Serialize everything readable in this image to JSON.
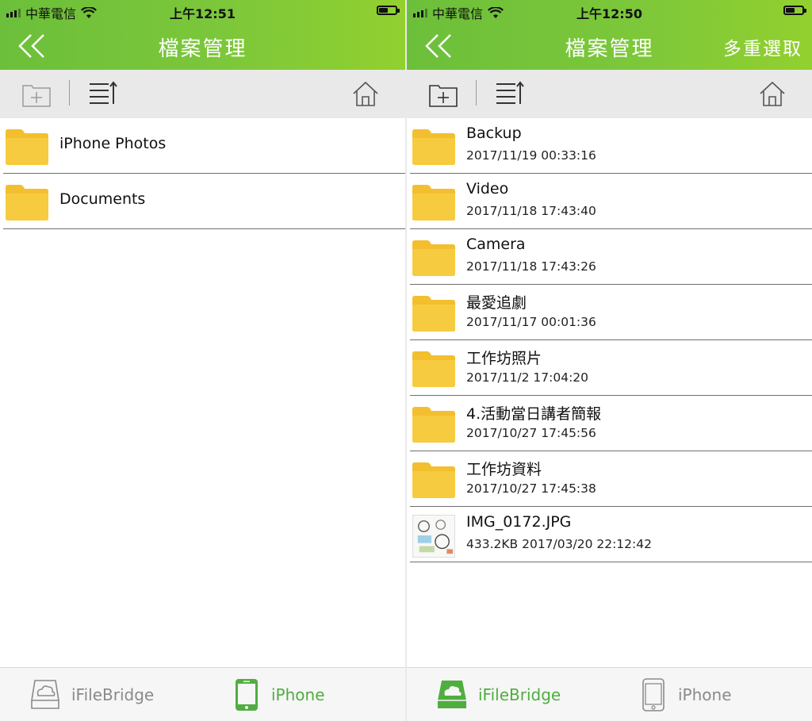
{
  "colors": {
    "accent": "#5cb34a",
    "header_start": "#6cbf3a",
    "header_end": "#92d02f",
    "folder": "#f7c93b",
    "inactive": "#8a8a8a"
  },
  "left": {
    "status": {
      "carrier": "中華電信",
      "time": "上午12:51"
    },
    "nav": {
      "title": "檔案管理",
      "back_icon": "double-chevron-left-icon"
    },
    "toolbar": {
      "new_folder_icon": "new-folder-icon",
      "sort_icon": "sort-list-icon",
      "home_icon": "home-icon"
    },
    "items": [
      {
        "name": "iPhone Photos",
        "icon": "folder-icon"
      },
      {
        "name": "Documents",
        "icon": "folder-icon"
      }
    ],
    "tabs": [
      {
        "label": "iFileBridge",
        "icon": "ifilebridge-drive-icon",
        "active": false
      },
      {
        "label": "iPhone",
        "icon": "iphone-device-icon",
        "active": true
      }
    ]
  },
  "right": {
    "status": {
      "carrier": "中華電信",
      "time": "上午12:50"
    },
    "nav": {
      "title": "檔案管理",
      "action": "多重選取",
      "back_icon": "double-chevron-left-icon"
    },
    "toolbar": {
      "new_folder_icon": "new-folder-icon",
      "sort_icon": "sort-list-icon",
      "home_icon": "home-icon"
    },
    "items": [
      {
        "name": "Backup",
        "date": "2017/11/19 00:33:16",
        "icon": "folder-icon"
      },
      {
        "name": "Video",
        "date": "2017/11/18 17:43:40",
        "icon": "folder-icon"
      },
      {
        "name": "Camera",
        "date": "2017/11/18 17:43:26",
        "icon": "folder-icon"
      },
      {
        "name": "最愛追劇",
        "date": "2017/11/17 00:01:36",
        "icon": "folder-icon"
      },
      {
        "name": "工作坊照片",
        "date": "2017/11/2 17:04:20",
        "icon": "folder-icon"
      },
      {
        "name": "4.活動當日講者簡報",
        "date": "2017/10/27 17:45:56",
        "icon": "folder-icon"
      },
      {
        "name": "工作坊資料",
        "date": "2017/10/27 17:45:38",
        "icon": "folder-icon"
      },
      {
        "name": "IMG_0172.JPG",
        "meta": "433.2KB  2017/03/20 22:12:42",
        "icon": "image-thumbnail"
      }
    ],
    "tabs": [
      {
        "label": "iFileBridge",
        "icon": "ifilebridge-drive-icon",
        "active": true
      },
      {
        "label": "iPhone",
        "icon": "iphone-device-icon",
        "active": false
      }
    ]
  }
}
